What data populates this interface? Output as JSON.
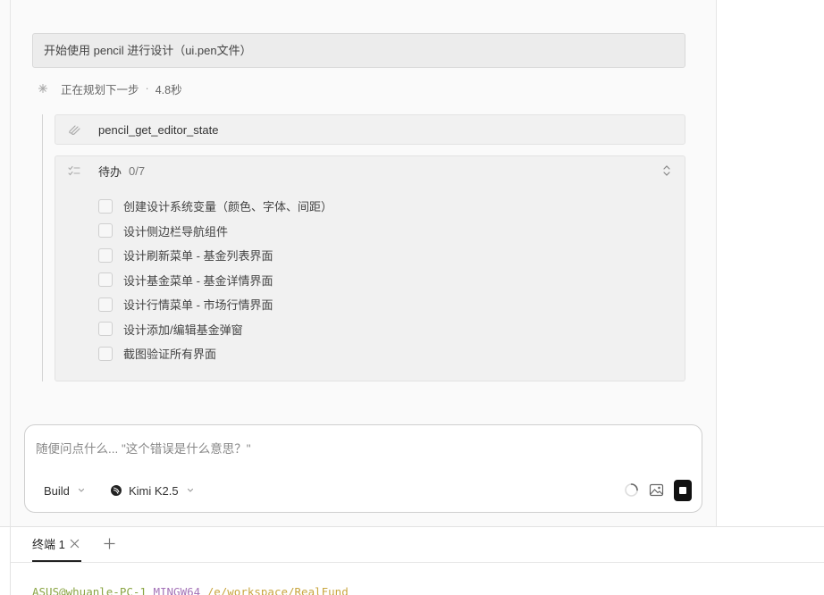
{
  "chat": {
    "user_message": "开始使用 pencil 进行设计（ui.pen文件）",
    "status": {
      "text": "正在规划下一步",
      "separator": "·",
      "duration": "4.8秒"
    },
    "tool_call": {
      "icon": "scribble-icon",
      "name": "pencil_get_editor_state"
    },
    "todo": {
      "icon": "list-check-icon",
      "title": "待办",
      "count": "0/7",
      "items": [
        {
          "label": "创建设计系统变量（颜色、字体、间距）",
          "checked": false
        },
        {
          "label": "设计侧边栏导航组件",
          "checked": false
        },
        {
          "label": "设计刷新菜单 - 基金列表界面",
          "checked": false
        },
        {
          "label": "设计基金菜单 - 基金详情界面",
          "checked": false
        },
        {
          "label": "设计行情菜单 - 市场行情界面",
          "checked": false
        },
        {
          "label": "设计添加/编辑基金弹窗",
          "checked": false
        },
        {
          "label": "截图验证所有界面",
          "checked": false
        }
      ]
    }
  },
  "composer": {
    "placeholder": "随便问点什么... \"这个错误是什么意思？\"",
    "value": "",
    "mode": "Build",
    "model": "Kimi K2.5",
    "model_icon": "kimi-logo-icon"
  },
  "terminal": {
    "tabs": [
      {
        "label": "终端 1"
      }
    ],
    "prompt": {
      "user_host": "ASUS@whuanle-PC-1",
      "system": "MINGW64",
      "path": "/e/workspace/RealFund"
    }
  },
  "colors": {
    "accent_dark": "#111111",
    "prompt_user": "#8aa544",
    "prompt_system": "#a574b8",
    "prompt_path": "#c9a640"
  }
}
